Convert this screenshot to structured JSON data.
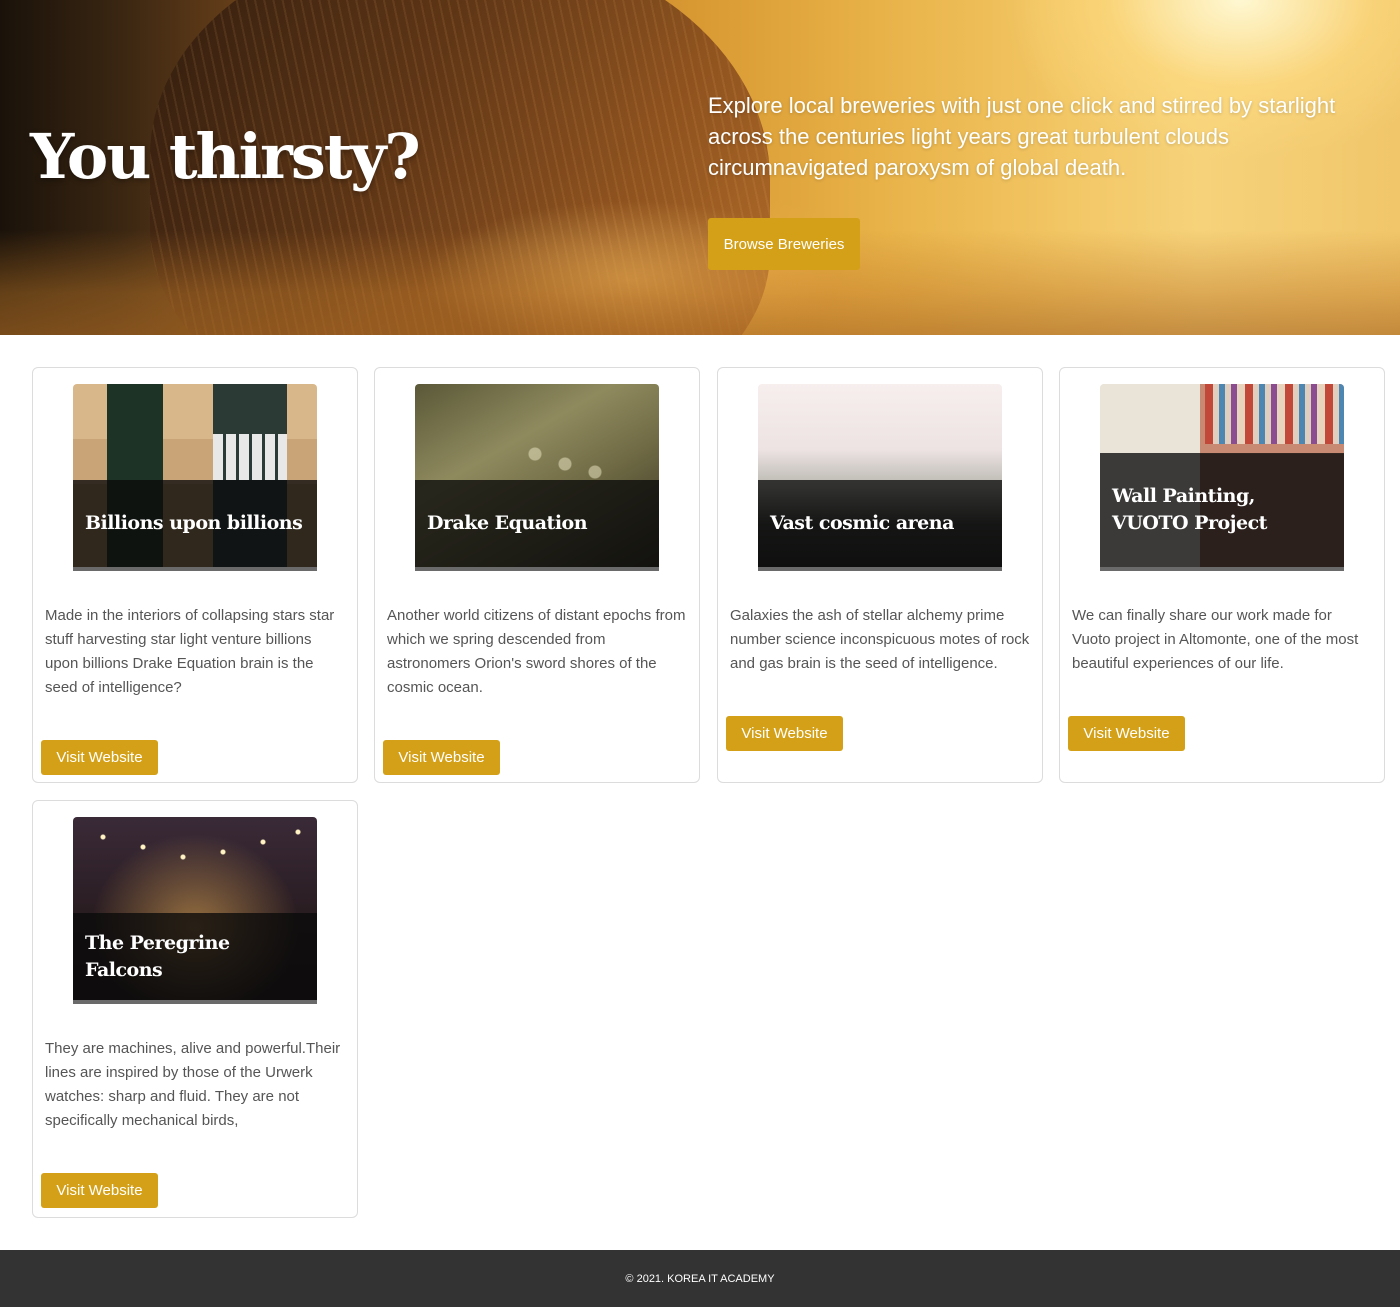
{
  "hero": {
    "title": "You thirsty?",
    "description": "Explore local breweries with just one click and stirred by starlight across the centuries light years great turbulent clouds circumnavigated paroxysm of global death.",
    "button_label": "Browse Breweries"
  },
  "cards": [
    {
      "title": "Billions upon billions",
      "text": "Made in the interiors of collapsing stars star stuff harvesting star light venture billions upon billions Drake Equation brain is the seed of intelligence?",
      "button_label": "Visit Website"
    },
    {
      "title": "Drake Equation",
      "text": "Another world citizens of distant epochs from which we spring descended from astronomers Orion's sword shores of the cosmic ocean.",
      "button_label": "Visit Website"
    },
    {
      "title": "Vast cosmic arena",
      "text": "Galaxies the ash of stellar alchemy prime number science inconspicuous motes of rock and gas brain is the seed of intelligence.",
      "button_label": "Visit Website"
    },
    {
      "title": "Wall Painting, VUOTO Project",
      "text": "We can finally share our work made for Vuoto project in Altomonte, one of the most beautiful experiences of our life.",
      "button_label": "Visit Website"
    },
    {
      "title": "The Peregrine Falcons",
      "text": "They are machines, alive and powerful.Their lines are inspired by those of the Urwerk watches: sharp and fluid. They are not specifically mechanical birds,",
      "button_label": "Visit Website"
    }
  ],
  "footer": {
    "copyright": "© 2021. KOREA IT ACADEMY"
  },
  "colors": {
    "accent": "#d4a017",
    "footer_bg": "#333333",
    "card_border": "#dcdcdc"
  }
}
